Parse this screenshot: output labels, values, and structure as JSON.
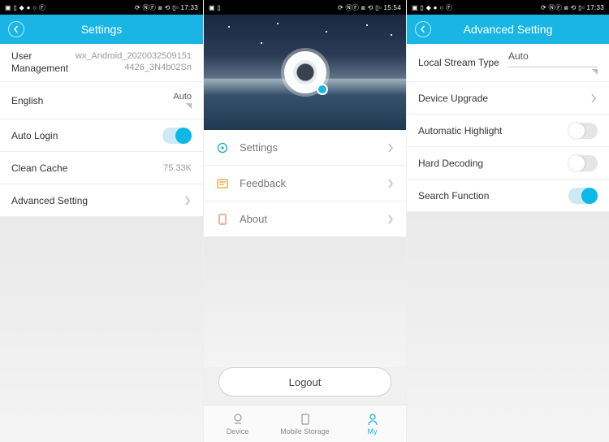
{
  "status": {
    "left": "▣ ▯ ◆ ● ○ Ⓕ",
    "right_a": "⟳ ⓃⒻ ⧈ ⟲ ▯▫ 17:33",
    "right_b": "⟳ ⓃⒻ ⧈ ⟲ ▯▫ 15:54",
    "left_b": "▣ ▯"
  },
  "screen1": {
    "title": "Settings",
    "user_label": "User Management",
    "user_value1": "wx_Android_2020032509151",
    "user_value2": "4426_3N4b02Sn",
    "lang_label": "English",
    "lang_value": "Auto",
    "autologin_label": "Auto Login",
    "autologin_on": true,
    "cache_label": "Clean Cache",
    "cache_value": "75.33K",
    "advanced_label": "Advanced Setting"
  },
  "screen2": {
    "menu": {
      "settings": "Settings",
      "feedback": "Feedback",
      "about": "About"
    },
    "logout": "Logout",
    "tabs": {
      "device": "Device",
      "storage": "Mobile Storage",
      "my": "My"
    }
  },
  "screen3": {
    "title": "Advanced Setting",
    "rows": {
      "stream_label": "Local Stream Type",
      "stream_value": "Auto",
      "upgrade": "Device Upgrade",
      "highlight": "Automatic Highlight",
      "hard": "Hard Decoding",
      "search": "Search Function"
    },
    "switches": {
      "highlight": false,
      "hard": false,
      "search": true
    }
  }
}
